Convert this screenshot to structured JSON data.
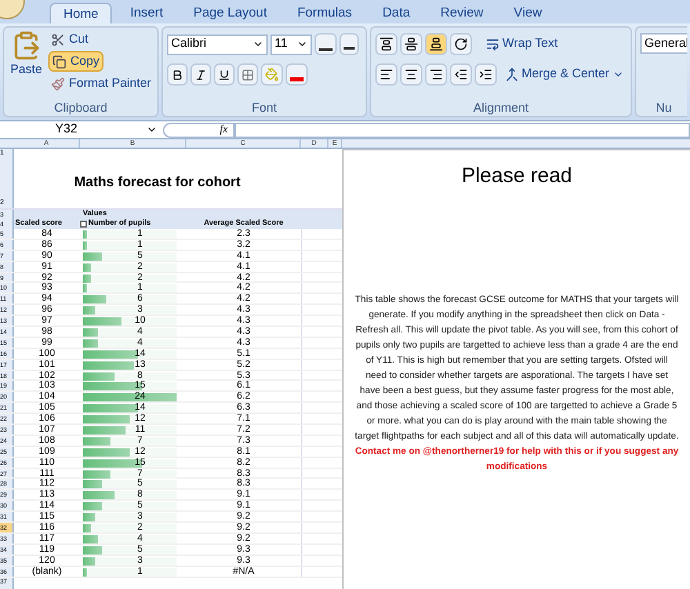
{
  "ribbon": {
    "tabs": [
      {
        "label": "Home",
        "selected": true
      },
      {
        "label": "Insert",
        "selected": false
      },
      {
        "label": "Page Layout",
        "selected": false
      },
      {
        "label": "Formulas",
        "selected": false
      },
      {
        "label": "Data",
        "selected": false
      },
      {
        "label": "Review",
        "selected": false
      },
      {
        "label": "View",
        "selected": false
      }
    ],
    "clipboard": {
      "label": "Clipboard",
      "paste": "Paste",
      "cut": "Cut",
      "copy": "Copy",
      "format_painter": "Format Painter"
    },
    "font": {
      "label": "Font",
      "family": "Calibri",
      "size": "11"
    },
    "alignment": {
      "label": "Alignment",
      "wrap_text": "Wrap Text",
      "merge": "Merge & Center"
    },
    "number": {
      "label": "Nu",
      "format": "General"
    }
  },
  "formula_bar": {
    "cell": "Y32",
    "fx": "fx"
  },
  "columns": [
    "A",
    "B",
    "C",
    "D",
    "E"
  ],
  "sheet": {
    "title": "Maths forecast for cohort",
    "title_row": "2",
    "header_rows": [
      {
        "row": "3",
        "values_label": "Values"
      },
      {
        "row": "4",
        "scaled": "Scaled score",
        "pupils": "Number of pupils",
        "average": "Average Scaled Score"
      }
    ],
    "top_row": "1",
    "rows": [
      {
        "row": "5",
        "score": "84",
        "pupils": "1",
        "level": 0.042,
        "average": "2.3",
        "selected": false
      },
      {
        "row": "6",
        "score": "86",
        "pupils": "1",
        "level": 0.042,
        "average": "3.2",
        "selected": false
      },
      {
        "row": "7",
        "score": "90",
        "pupils": "5",
        "level": 0.208,
        "average": "4.1",
        "selected": false
      },
      {
        "row": "8",
        "score": "91",
        "pupils": "2",
        "level": 0.083,
        "average": "4.1",
        "selected": false
      },
      {
        "row": "9",
        "score": "92",
        "pupils": "2",
        "level": 0.083,
        "average": "4.2",
        "selected": false
      },
      {
        "row": "10",
        "score": "93",
        "pupils": "1",
        "level": 0.042,
        "average": "4.2",
        "selected": false
      },
      {
        "row": "11",
        "score": "94",
        "pupils": "6",
        "level": 0.25,
        "average": "4.2",
        "selected": false
      },
      {
        "row": "12",
        "score": "96",
        "pupils": "3",
        "level": 0.125,
        "average": "4.3",
        "selected": false
      },
      {
        "row": "13",
        "score": "97",
        "pupils": "10",
        "level": 0.417,
        "average": "4.3",
        "selected": false
      },
      {
        "row": "14",
        "score": "98",
        "pupils": "4",
        "level": 0.167,
        "average": "4.3",
        "selected": false
      },
      {
        "row": "15",
        "score": "99",
        "pupils": "4",
        "level": 0.167,
        "average": "4.3",
        "selected": false
      },
      {
        "row": "16",
        "score": "100",
        "pupils": "14",
        "level": 0.583,
        "average": "5.1",
        "selected": false
      },
      {
        "row": "17",
        "score": "101",
        "pupils": "13",
        "level": 0.542,
        "average": "5.2",
        "selected": false
      },
      {
        "row": "18",
        "score": "102",
        "pupils": "8",
        "level": 0.333,
        "average": "5.3",
        "selected": false
      },
      {
        "row": "19",
        "score": "103",
        "pupils": "15",
        "level": 0.625,
        "average": "6.1",
        "selected": false
      },
      {
        "row": "20",
        "score": "104",
        "pupils": "24",
        "level": 1,
        "average": "6.2",
        "selected": false
      },
      {
        "row": "21",
        "score": "105",
        "pupils": "14",
        "level": 0.583,
        "average": "6.3",
        "selected": false
      },
      {
        "row": "22",
        "score": "106",
        "pupils": "12",
        "level": 0.5,
        "average": "7.1",
        "selected": false
      },
      {
        "row": "23",
        "score": "107",
        "pupils": "11",
        "level": 0.458,
        "average": "7.2",
        "selected": false
      },
      {
        "row": "24",
        "score": "108",
        "pupils": "7",
        "level": 0.292,
        "average": "7.3",
        "selected": false
      },
      {
        "row": "25",
        "score": "109",
        "pupils": "12",
        "level": 0.5,
        "average": "8.1",
        "selected": false
      },
      {
        "row": "26",
        "score": "110",
        "pupils": "15",
        "level": 0.625,
        "average": "8.2",
        "selected": false
      },
      {
        "row": "27",
        "score": "111",
        "pupils": "7",
        "level": 0.292,
        "average": "8.3",
        "selected": false
      },
      {
        "row": "28",
        "score": "112",
        "pupils": "5",
        "level": 0.208,
        "average": "8.3",
        "selected": false
      },
      {
        "row": "29",
        "score": "113",
        "pupils": "8",
        "level": 0.333,
        "average": "9.1",
        "selected": false
      },
      {
        "row": "30",
        "score": "114",
        "pupils": "5",
        "level": 0.208,
        "average": "9.1",
        "selected": false
      },
      {
        "row": "31",
        "score": "115",
        "pupils": "3",
        "level": 0.125,
        "average": "9.2",
        "selected": false
      },
      {
        "row": "32",
        "score": "116",
        "pupils": "2",
        "level": 0.083,
        "average": "9.2",
        "selected": true
      },
      {
        "row": "33",
        "score": "117",
        "pupils": "4",
        "level": 0.167,
        "average": "9.2",
        "selected": false
      },
      {
        "row": "34",
        "score": "119",
        "pupils": "5",
        "level": 0.208,
        "average": "9.3",
        "selected": false
      },
      {
        "row": "35",
        "score": "120",
        "pupils": "3",
        "level": 0.125,
        "average": "9.3",
        "selected": false
      },
      {
        "row": "36",
        "score": "(blank)",
        "pupils": "1",
        "level": 0.042,
        "average": "#N/A",
        "selected": false
      }
    ],
    "end_row": "37"
  },
  "note": {
    "title": "Please read",
    "text": "This table shows the forecast GCSE outcome for MATHS that your targets will generate. If you modify anything in the spreadsheet then click on Data - Refresh all. This will update the pivot table. As you will see, from this cohort of pupils only two pupils are targetted to achieve less than a grade 4 are the end of Y11. This is high but remember that you are setting targets. Ofsted will need to consider whether targets are asporational. The targets I have set have been a best guess, but they assume faster progress for the most able, and those achieving a scaled score of 100 are targetted to achieve a Grade 5 or more. what you can do is play around with the main table showing the target flightpaths for each subject and all of this data will automatically update. **Contact me on @thenortherner19 for help with this or if you suggest any modifications**"
  }
}
